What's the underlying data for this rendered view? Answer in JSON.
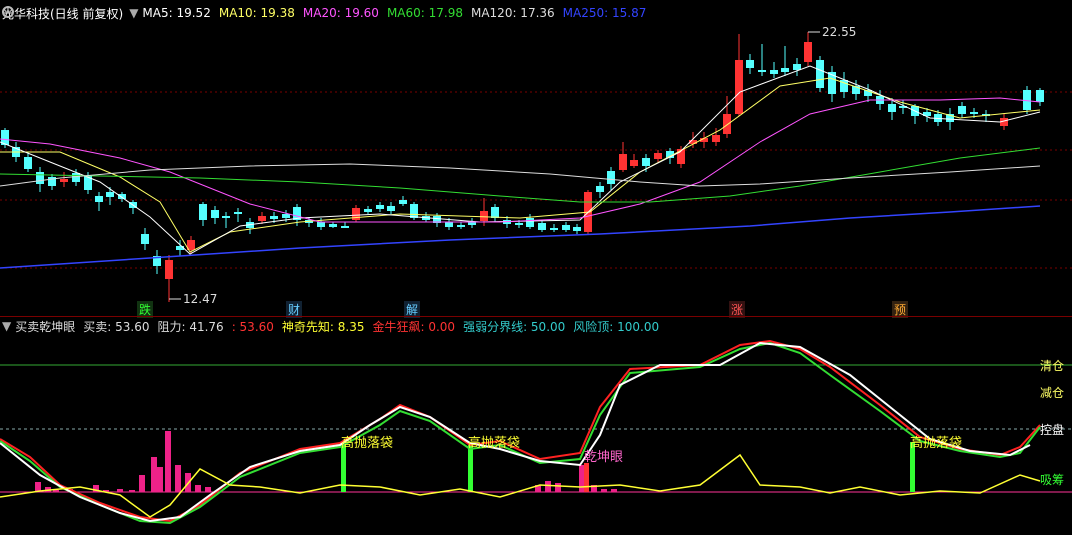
{
  "header": {
    "symbol": "光华科技(日线 前复权)",
    "ma": [
      {
        "label": "MA5: 19.52",
        "color": "#ffffff"
      },
      {
        "label": "MA10: 19.38",
        "color": "#ffff66"
      },
      {
        "label": "MA20: 19.60",
        "color": "#ff55ff"
      },
      {
        "label": "MA60: 17.98",
        "color": "#33dd33"
      },
      {
        "label": "MA120: 17.36",
        "color": "#dddddd"
      },
      {
        "label": "MA250: 15.87",
        "color": "#3344ff"
      }
    ]
  },
  "main_chart": {
    "high_label": "22.55",
    "low_label": "12.47",
    "event_markers": [
      "跌",
      "财",
      "解",
      "涨",
      "预"
    ]
  },
  "indicator": {
    "name": "买卖乾坤眼",
    "values": [
      {
        "label": "买卖: 53.60",
        "color": "#dddddd"
      },
      {
        "label": "阻力: 41.76",
        "color": "#dddddd"
      },
      {
        "label": ": 53.60",
        "color": "#ff3333"
      },
      {
        "label": "神奇先知: 8.35",
        "color": "#ffff33"
      },
      {
        "label": "金牛狂飙: 0.00",
        "color": "#ff3333"
      },
      {
        "label": "强弱分界线: 50.00",
        "color": "#33cccc"
      },
      {
        "label": "风险顶: 100.00",
        "color": "#33cccc"
      }
    ],
    "right_labels": [
      "清仓",
      "减仓",
      "控盘",
      "吸筹"
    ],
    "annotations": [
      "高抛落袋",
      "高抛落袋",
      "乾坤眼",
      "高抛落袋"
    ]
  },
  "colors": {
    "up": "#ff3333",
    "down": "#55ffff",
    "grid": "#7a0000"
  }
}
